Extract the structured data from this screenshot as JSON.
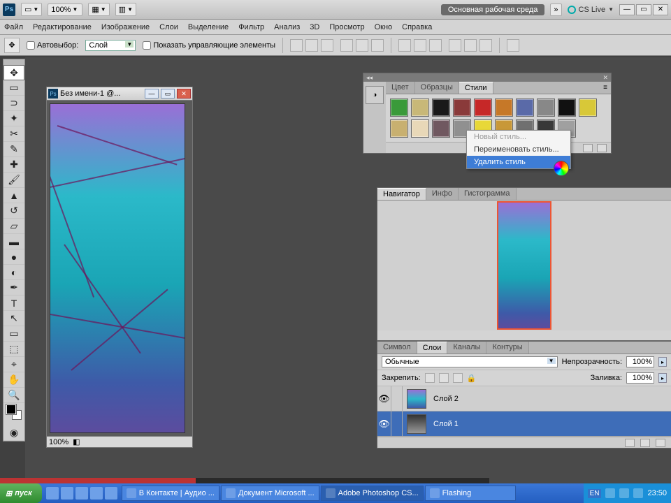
{
  "app": {
    "logo": "Ps",
    "zoom": "100%",
    "workspace_label": "Основная рабочая среда",
    "cslive": "CS Live"
  },
  "winbtns": {
    "min": "—",
    "max": "▭",
    "close": "✕"
  },
  "menu": {
    "items": [
      "Файл",
      "Редактирование",
      "Изображение",
      "Слои",
      "Выделение",
      "Фильтр",
      "Анализ",
      "3D",
      "Просмотр",
      "Окно",
      "Справка"
    ]
  },
  "options": {
    "autoselect_label": "Автовыбор:",
    "autoselect_value": "Слой",
    "transform_label": "Показать управляющие элементы"
  },
  "doc": {
    "title": "Без имени-1 @...",
    "zoom": "100%"
  },
  "styles_panel": {
    "tabs": [
      "Цвет",
      "Образцы",
      "Стили"
    ],
    "swatches_row1": [
      "#3a9a3a",
      "#c8b878",
      "#1a1a1a",
      "#8a3a3a",
      "#c62828",
      "#c67828",
      "#5a6aa8",
      "#888888",
      "#111111",
      "#d8c838"
    ],
    "swatches_row2": [
      "#c8b070",
      "#e8d8b8",
      "#705860",
      "#909090",
      "#e8d838",
      "#c89838",
      "#707070",
      "#383838",
      "#a0a0a0"
    ]
  },
  "context_menu": {
    "items": [
      {
        "label": "Новый стиль...",
        "state": "disabled"
      },
      {
        "label": "Переименовать стиль...",
        "state": "normal"
      },
      {
        "label": "Удалить стиль",
        "state": "highlight"
      }
    ]
  },
  "navigator": {
    "tabs": [
      "Навигатор",
      "Инфо",
      "Гистограмма"
    ]
  },
  "layers": {
    "tabs": [
      "Символ",
      "Слои",
      "Каналы",
      "Контуры"
    ],
    "blend_mode": "Обычные",
    "opacity_label": "Непрозрачность:",
    "opacity_value": "100%",
    "lock_label": "Закрепить:",
    "fill_label": "Заливка:",
    "fill_value": "100%",
    "rows": [
      {
        "name": "Слой 2",
        "selected": false,
        "thumb_bg": "linear-gradient(180deg,#9a6fd6,#2bb9c9,#3e5aa8)"
      },
      {
        "name": "Слой 1",
        "selected": true,
        "thumb_bg": "linear-gradient(180deg,#333,#999)"
      }
    ]
  },
  "taskbar": {
    "start": "пуск",
    "buttons": [
      {
        "label": "В Контакте | Аудио ..."
      },
      {
        "label": "Документ Microsoft ..."
      },
      {
        "label": "Adobe Photoshop CS...",
        "active": true
      },
      {
        "label": "Flashing"
      }
    ],
    "lang": "EN",
    "clock": "23:50"
  }
}
